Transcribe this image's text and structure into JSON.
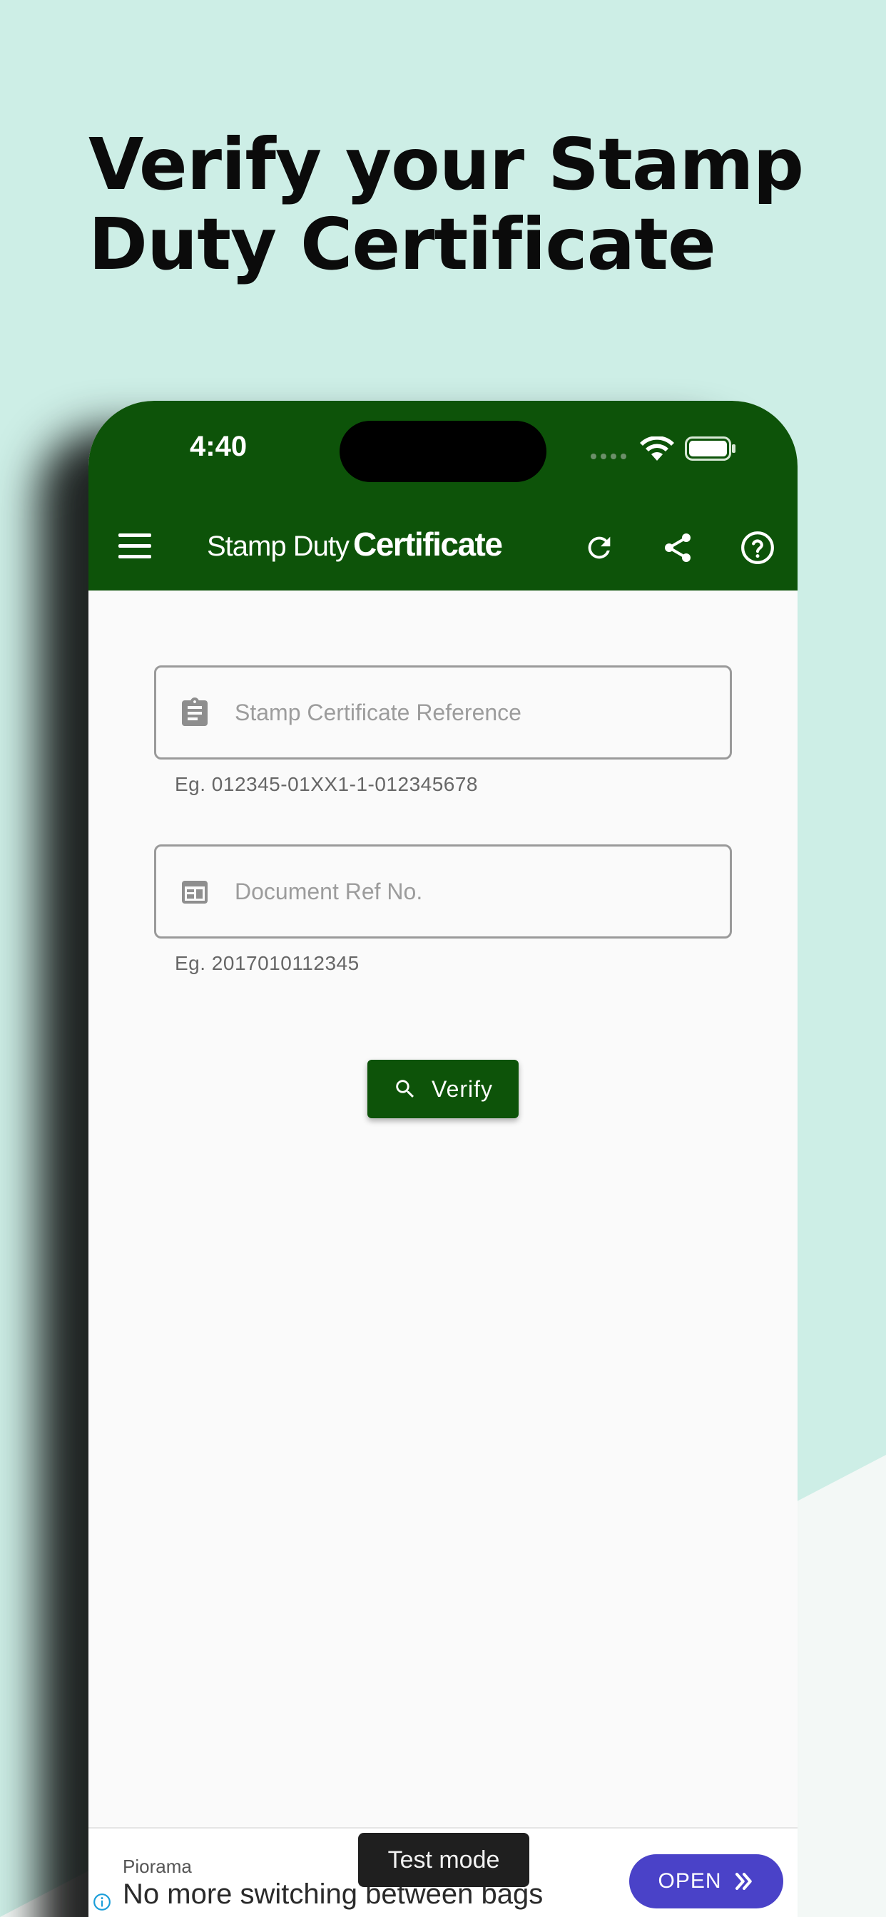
{
  "headline": {
    "line1": "Verify your Stamp",
    "line2": "Duty Certificate"
  },
  "status_bar": {
    "time": "4:40",
    "icons": [
      "signal-dots-icon",
      "wifi-icon",
      "battery-icon"
    ]
  },
  "app_bar": {
    "title_light": "Stamp Duty",
    "title_bold": "Certificate",
    "icons": [
      "menu-icon",
      "refresh-icon",
      "share-icon",
      "help-icon"
    ]
  },
  "form": {
    "certificate_field": {
      "placeholder": "Stamp Certificate Reference",
      "value": "",
      "hint": "Eg. 012345-01XX1-1-012345678",
      "icon": "clipboard-icon"
    },
    "document_field": {
      "placeholder": "Document Ref No.",
      "value": "",
      "hint": "Eg. 2017010112345",
      "icon": "web-asset-icon"
    },
    "verify_button": {
      "label": "Verify",
      "icon": "search-icon"
    }
  },
  "ad": {
    "advertiser": "Piorama",
    "headline": "No more switching between bags",
    "cta": "OPEN",
    "test_mode_label": "Test mode"
  },
  "colors": {
    "background": "#cdeee6",
    "app_green": "#0d5309",
    "ad_button": "#4a42c8"
  }
}
